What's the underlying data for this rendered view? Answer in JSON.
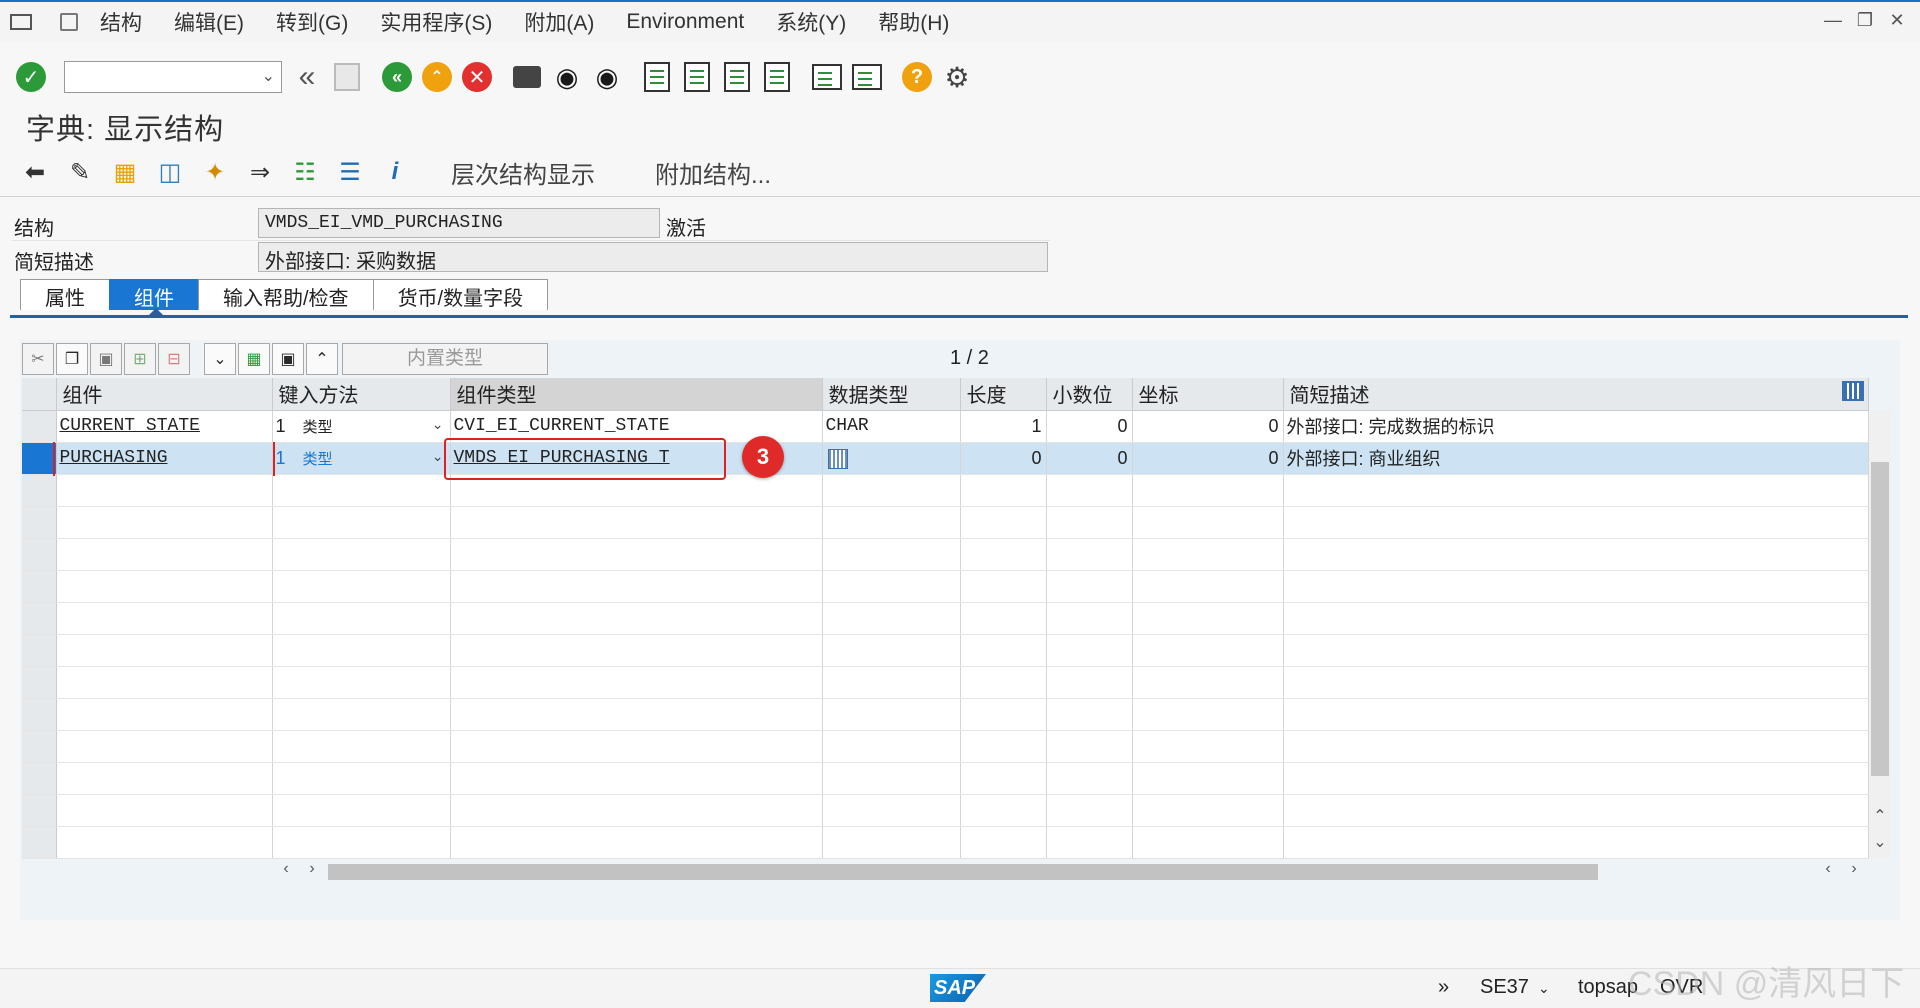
{
  "menu": {
    "items": [
      "结构",
      "编辑(E)",
      "转到(G)",
      "实用程序(S)",
      "附加(A)",
      "Environment",
      "系统(Y)",
      "帮助(H)"
    ]
  },
  "toolbar": {
    "command_field_value": "",
    "icons": [
      "enter-icon",
      "back-double-icon",
      "save-icon",
      "back-icon",
      "exit-icon",
      "cancel-icon",
      "print-icon",
      "find-icon",
      "find-next-icon",
      "first-page-icon",
      "previous-page-icon",
      "next-page-icon",
      "last-page-icon",
      "new-session-icon",
      "shortcut-icon",
      "help-icon",
      "settings-icon"
    ]
  },
  "page": {
    "title": "字典: 显示结构"
  },
  "app_toolbar": {
    "hierarchy_label": "层次结构显示",
    "append_label": "附加结构..."
  },
  "header": {
    "structure_label": "结构",
    "structure_value": "VMDS_EI_VMD_PURCHASING",
    "status": "激活",
    "short_desc_label": "简短描述",
    "short_desc_value": "外部接口: 采购数据"
  },
  "tabs": [
    {
      "label": "属性",
      "active": false
    },
    {
      "label": "组件",
      "active": true
    },
    {
      "label": "输入帮助/检查",
      "active": false
    },
    {
      "label": "货币/数量字段",
      "active": false
    }
  ],
  "table_toolbar": {
    "builtin_type_label": "内置类型",
    "pager": "1 / 2"
  },
  "table": {
    "columns": [
      "组件",
      "键入方法",
      "组件类型",
      "数据类型",
      "长度",
      "小数位",
      "坐标",
      "简短描述"
    ],
    "rows": [
      {
        "component": "CURRENT_STATE",
        "typing_num": "1",
        "typing_text": "类型",
        "component_type": "CVI_EI_CURRENT_STATE",
        "data_type": "CHAR",
        "length": "1",
        "decimals": "0",
        "coordinate": "0",
        "description": "外部接口: 完成数据的标识"
      },
      {
        "component": "PURCHASING",
        "typing_num": "1",
        "typing_text": "类型",
        "component_type": "VMDS_EI_PURCHASING_T",
        "data_type": "",
        "length": "0",
        "decimals": "0",
        "coordinate": "0",
        "description": "外部接口: 商业组织"
      }
    ],
    "selected_row": 1
  },
  "annotation": {
    "badge": "3",
    "color": "#e02020"
  },
  "status_bar": {
    "transaction": "SE37",
    "system": "topsap",
    "mode": "OVR",
    "logo_text": "SAP"
  },
  "watermark": "CSDN @清风日下",
  "colors": {
    "accent": "#1976d2",
    "selected_row": "#cde3f4",
    "highlight": "#e02020"
  }
}
